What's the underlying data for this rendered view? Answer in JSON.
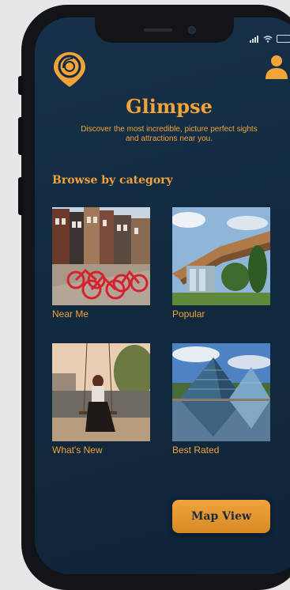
{
  "app": {
    "name": "Glimpse",
    "tagline": "Discover the most incredible, picture perfect sights and attractions near you."
  },
  "section_title": "Browse by category",
  "categories": [
    {
      "label": "Near Me",
      "image": "bicycle-street-photo"
    },
    {
      "label": "Popular",
      "image": "modern-building-photo"
    },
    {
      "label": "What's New",
      "image": "swing-beach-photo"
    },
    {
      "label": "Best Rated",
      "image": "glass-pyramid-photo"
    }
  ],
  "map_button_label": "Map View",
  "icons": [
    "logo-pin-icon",
    "user-icon",
    "signal-icon",
    "wifi-icon",
    "battery-icon"
  ],
  "colors": {
    "accent": "#f2a33a",
    "background": "#112a40"
  }
}
